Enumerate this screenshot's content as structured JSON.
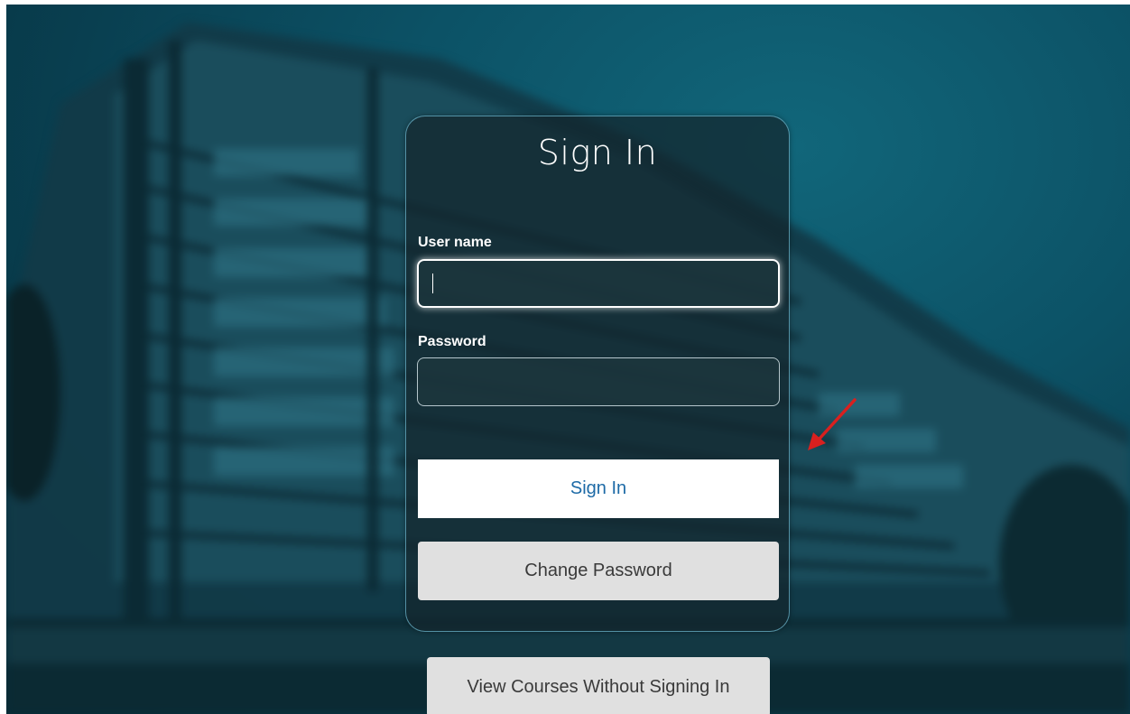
{
  "page": {
    "title": "Sign In"
  },
  "form": {
    "username_label": "User name",
    "username_value": "",
    "password_label": "Password",
    "password_value": "",
    "signin_label": "Sign In",
    "change_password_label": "Change Password"
  },
  "footer": {
    "view_courses_label": "View Courses Without Signing In"
  },
  "icons": {
    "annotation": "red-arrow-icon"
  },
  "colors": {
    "background": "#0c5266",
    "card_border": "#78c8e1",
    "signin_text": "#1d6aa6",
    "secondary_button": "#e0e0e0",
    "annotation_arrow": "#d9201f"
  }
}
